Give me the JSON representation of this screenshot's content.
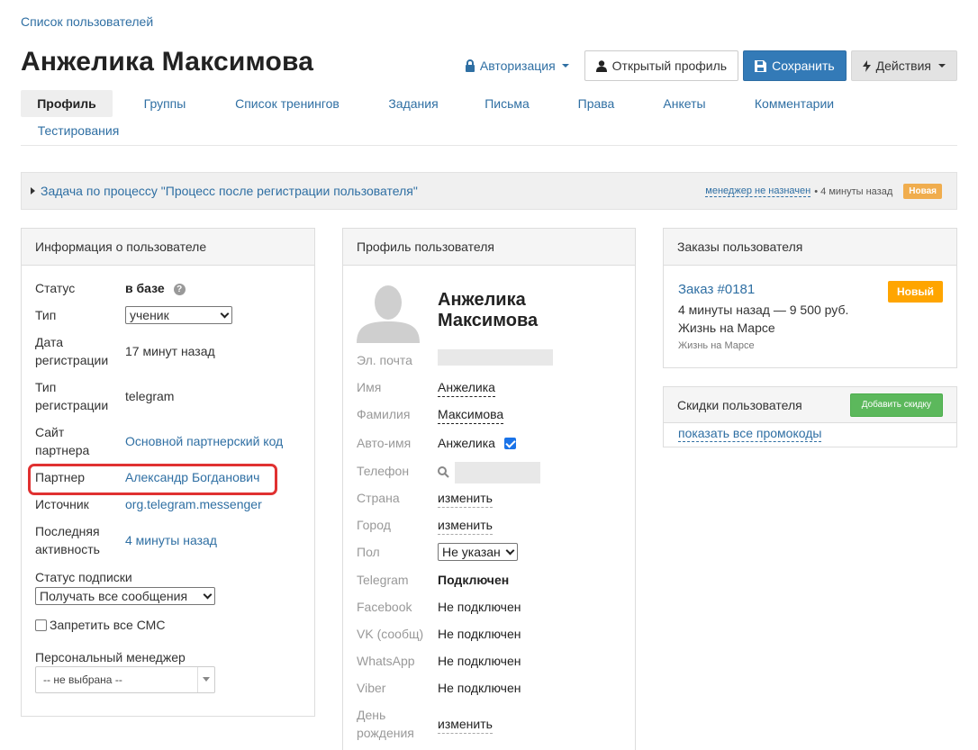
{
  "breadcrumb": "Список пользователей",
  "title": "Анжелика Максимова",
  "header": {
    "auth_label": "Авторизация",
    "open_profile_label": "Открытый профиль",
    "save_label": "Сохранить",
    "actions_label": "Действия"
  },
  "tabs": [
    "Профиль",
    "Группы",
    "Список тренингов",
    "Задания",
    "Письма",
    "Права",
    "Анкеты",
    "Комментарии",
    "Тестирования"
  ],
  "active_tab": "Профиль",
  "task": {
    "label": "Задача по процессу \"Процесс после регистрации пользователя\"",
    "manager": "менеджер не назначен",
    "time": "• 4 минуты назад",
    "badge": "Новая"
  },
  "user_info": {
    "heading": "Информация о пользователе",
    "status_label": "Статус",
    "status_value": "в базе",
    "type_label": "Тип",
    "type_value": "ученик",
    "reg_date_label_1": "Дата",
    "reg_date_label_2": "регистрации",
    "reg_date_value": "17 минут назад",
    "reg_type_label_1": "Тип",
    "reg_type_label_2": "регистрации",
    "reg_type_value": "telegram",
    "partner_site_label_1": "Сайт",
    "partner_site_label_2": "партнера",
    "partner_site_value": "Основной партнерский код",
    "partner_label": "Партнер",
    "partner_value": "Александр Богданович",
    "source_label": "Источник",
    "source_value": "org.telegram.messenger",
    "last_activity_label_1": "Последняя",
    "last_activity_label_2": "активность",
    "last_activity_value": "4 минуты назад",
    "subscription_label": "Статус подписки",
    "subscription_value": "Получать все сообщения",
    "sms_label": "Запретить все СМС",
    "manager_label": "Персональный менеджер",
    "manager_value": "-- не выбрана --"
  },
  "profile": {
    "heading": "Профиль пользователя",
    "name_line1": "Анжелика",
    "name_line2": "Максимова",
    "email_label": "Эл. почта",
    "first_name_label": "Имя",
    "first_name_value": "Анжелика",
    "last_name_label": "Фамилия",
    "last_name_value": "Максимова",
    "auto_name_label": "Авто-имя",
    "auto_name_value": "Анжелика",
    "phone_label": "Телефон",
    "country_label": "Страна",
    "country_value": "изменить",
    "city_label": "Город",
    "city_value": "изменить",
    "gender_label": "Пол",
    "gender_value": "Не указан",
    "telegram_label": "Telegram",
    "telegram_value": "Подключен",
    "facebook_label": "Facebook",
    "facebook_value": "Не подключен",
    "vk_label": "VK (сообщ)",
    "vk_value": "Не подключен",
    "whatsapp_label": "WhatsApp",
    "whatsapp_value": "Не подключен",
    "viber_label": "Viber",
    "viber_value": "Не подключен",
    "birthday_label_1": "День",
    "birthday_label_2": "рождения",
    "birthday_value": "изменить"
  },
  "orders": {
    "heading": "Заказы пользователя",
    "order_link": "Заказ #0181",
    "order_badge": "Новый",
    "order_meta": "4 минуты назад — 9 500 руб.",
    "order_product": "Жизнь на Марсе",
    "order_offer": "Жизнь на Марсе"
  },
  "discounts": {
    "heading": "Скидки пользователя",
    "add_label": "Добавить скидку",
    "promo_link": "показать все промокоды"
  },
  "colors": {
    "link": "#2f6fa3",
    "primary": "#337ab7",
    "badge_orange": "#f0ad4e",
    "order_badge": "#ffa500",
    "green": "#5cb85c",
    "highlight": "#e03131"
  }
}
